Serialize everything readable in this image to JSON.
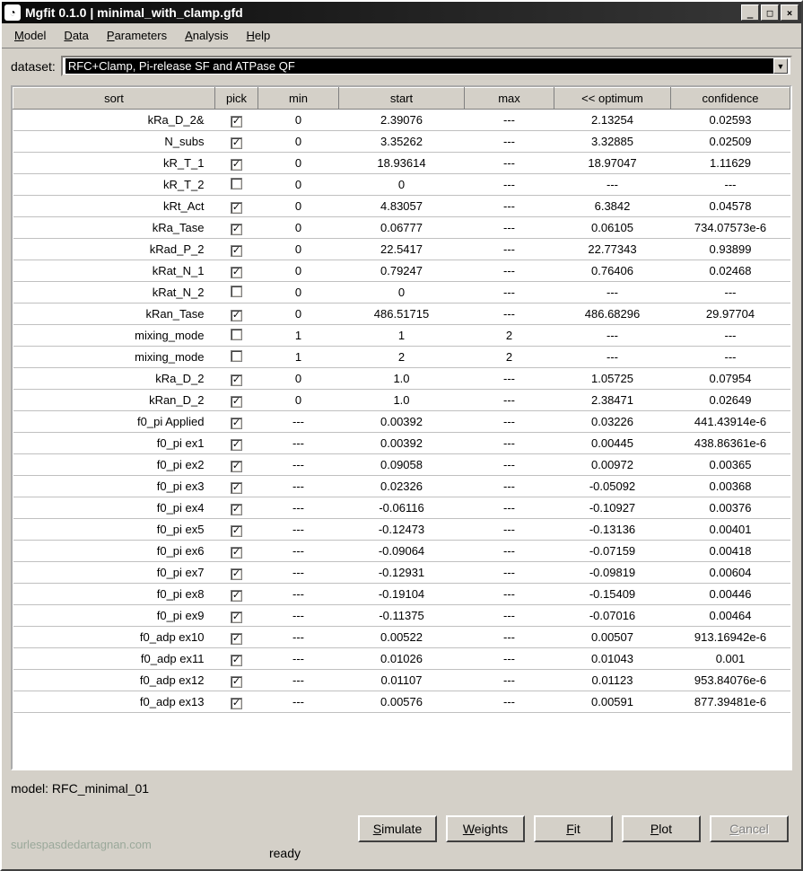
{
  "window": {
    "title": "Mgfit 0.1.0 | minimal_with_clamp.gfd"
  },
  "menus": [
    "Model",
    "Data",
    "Parameters",
    "Analysis",
    "Help"
  ],
  "dataset": {
    "label": "dataset:",
    "value": "RFC+Clamp, Pi-release SF and ATPase QF"
  },
  "columns": [
    "sort",
    "pick",
    "min",
    "start",
    "max",
    "<< optimum",
    "confidence"
  ],
  "rows": [
    {
      "sort": "kRa_D_2&",
      "pick": true,
      "min": "0",
      "start": "2.39076",
      "max": "---",
      "opt": "2.13254",
      "conf": "0.02593"
    },
    {
      "sort": "N_subs",
      "pick": true,
      "min": "0",
      "start": "3.35262",
      "max": "---",
      "opt": "3.32885",
      "conf": "0.02509"
    },
    {
      "sort": "kR_T_1",
      "pick": true,
      "min": "0",
      "start": "18.93614",
      "max": "---",
      "opt": "18.97047",
      "conf": "1.11629"
    },
    {
      "sort": "kR_T_2",
      "pick": false,
      "min": "0",
      "start": "0",
      "max": "---",
      "opt": "---",
      "conf": "---"
    },
    {
      "sort": "kRt_Act",
      "pick": true,
      "min": "0",
      "start": "4.83057",
      "max": "---",
      "opt": "6.3842",
      "conf": "0.04578"
    },
    {
      "sort": "kRa_Tase",
      "pick": true,
      "min": "0",
      "start": "0.06777",
      "max": "---",
      "opt": "0.06105",
      "conf": "734.07573e-6"
    },
    {
      "sort": "kRad_P_2",
      "pick": true,
      "min": "0",
      "start": "22.5417",
      "max": "---",
      "opt": "22.77343",
      "conf": "0.93899"
    },
    {
      "sort": "kRat_N_1",
      "pick": true,
      "min": "0",
      "start": "0.79247",
      "max": "---",
      "opt": "0.76406",
      "conf": "0.02468"
    },
    {
      "sort": "kRat_N_2",
      "pick": false,
      "min": "0",
      "start": "0",
      "max": "---",
      "opt": "---",
      "conf": "---"
    },
    {
      "sort": "kRan_Tase",
      "pick": true,
      "min": "0",
      "start": "486.51715",
      "max": "---",
      "opt": "486.68296",
      "conf": "29.97704"
    },
    {
      "sort": "mixing_mode",
      "pick": false,
      "min": "1",
      "start": "1",
      "max": "2",
      "opt": "---",
      "conf": "---"
    },
    {
      "sort": "mixing_mode",
      "pick": false,
      "min": "1",
      "start": "2",
      "max": "2",
      "opt": "---",
      "conf": "---"
    },
    {
      "sort": "kRa_D_2",
      "pick": true,
      "min": "0",
      "start": "1.0",
      "max": "---",
      "opt": "1.05725",
      "conf": "0.07954"
    },
    {
      "sort": "kRan_D_2",
      "pick": true,
      "min": "0",
      "start": "1.0",
      "max": "---",
      "opt": "2.38471",
      "conf": "0.02649"
    },
    {
      "sort": "f0_pi Applied",
      "pick": true,
      "min": "---",
      "start": "0.00392",
      "max": "---",
      "opt": "0.03226",
      "conf": "441.43914e-6"
    },
    {
      "sort": "f0_pi ex1",
      "pick": true,
      "min": "---",
      "start": "0.00392",
      "max": "---",
      "opt": "0.00445",
      "conf": "438.86361e-6"
    },
    {
      "sort": "f0_pi ex2",
      "pick": true,
      "min": "---",
      "start": "0.09058",
      "max": "---",
      "opt": "0.00972",
      "conf": "0.00365"
    },
    {
      "sort": "f0_pi ex3",
      "pick": true,
      "min": "---",
      "start": "0.02326",
      "max": "---",
      "opt": "-0.05092",
      "conf": "0.00368"
    },
    {
      "sort": "f0_pi ex4",
      "pick": true,
      "min": "---",
      "start": "-0.06116",
      "max": "---",
      "opt": "-0.10927",
      "conf": "0.00376"
    },
    {
      "sort": "f0_pi ex5",
      "pick": true,
      "min": "---",
      "start": "-0.12473",
      "max": "---",
      "opt": "-0.13136",
      "conf": "0.00401"
    },
    {
      "sort": "f0_pi ex6",
      "pick": true,
      "min": "---",
      "start": "-0.09064",
      "max": "---",
      "opt": "-0.07159",
      "conf": "0.00418"
    },
    {
      "sort": "f0_pi ex7",
      "pick": true,
      "min": "---",
      "start": "-0.12931",
      "max": "---",
      "opt": "-0.09819",
      "conf": "0.00604"
    },
    {
      "sort": "f0_pi ex8",
      "pick": true,
      "min": "---",
      "start": "-0.19104",
      "max": "---",
      "opt": "-0.15409",
      "conf": "0.00446"
    },
    {
      "sort": "f0_pi ex9",
      "pick": true,
      "min": "---",
      "start": "-0.11375",
      "max": "---",
      "opt": "-0.07016",
      "conf": "0.00464"
    },
    {
      "sort": "f0_adp ex10",
      "pick": true,
      "min": "---",
      "start": "0.00522",
      "max": "---",
      "opt": "0.00507",
      "conf": "913.16942e-6"
    },
    {
      "sort": "f0_adp ex11",
      "pick": true,
      "min": "---",
      "start": "0.01026",
      "max": "---",
      "opt": "0.01043",
      "conf": "0.001"
    },
    {
      "sort": "f0_adp ex12",
      "pick": true,
      "min": "---",
      "start": "0.01107",
      "max": "---",
      "opt": "0.01123",
      "conf": "953.84076e-6"
    },
    {
      "sort": "f0_adp ex13",
      "pick": true,
      "min": "---",
      "start": "0.00576",
      "max": "---",
      "opt": "0.00591",
      "conf": "877.39481e-6"
    }
  ],
  "model": {
    "label": "model: ",
    "value": "RFC_minimal_01"
  },
  "buttons": {
    "simulate": "Simulate",
    "weights": "Weights",
    "fit": "Fit",
    "plot": "Plot",
    "cancel": "Cancel"
  },
  "status": "ready",
  "watermark": "surlespasdedartagnan.com"
}
